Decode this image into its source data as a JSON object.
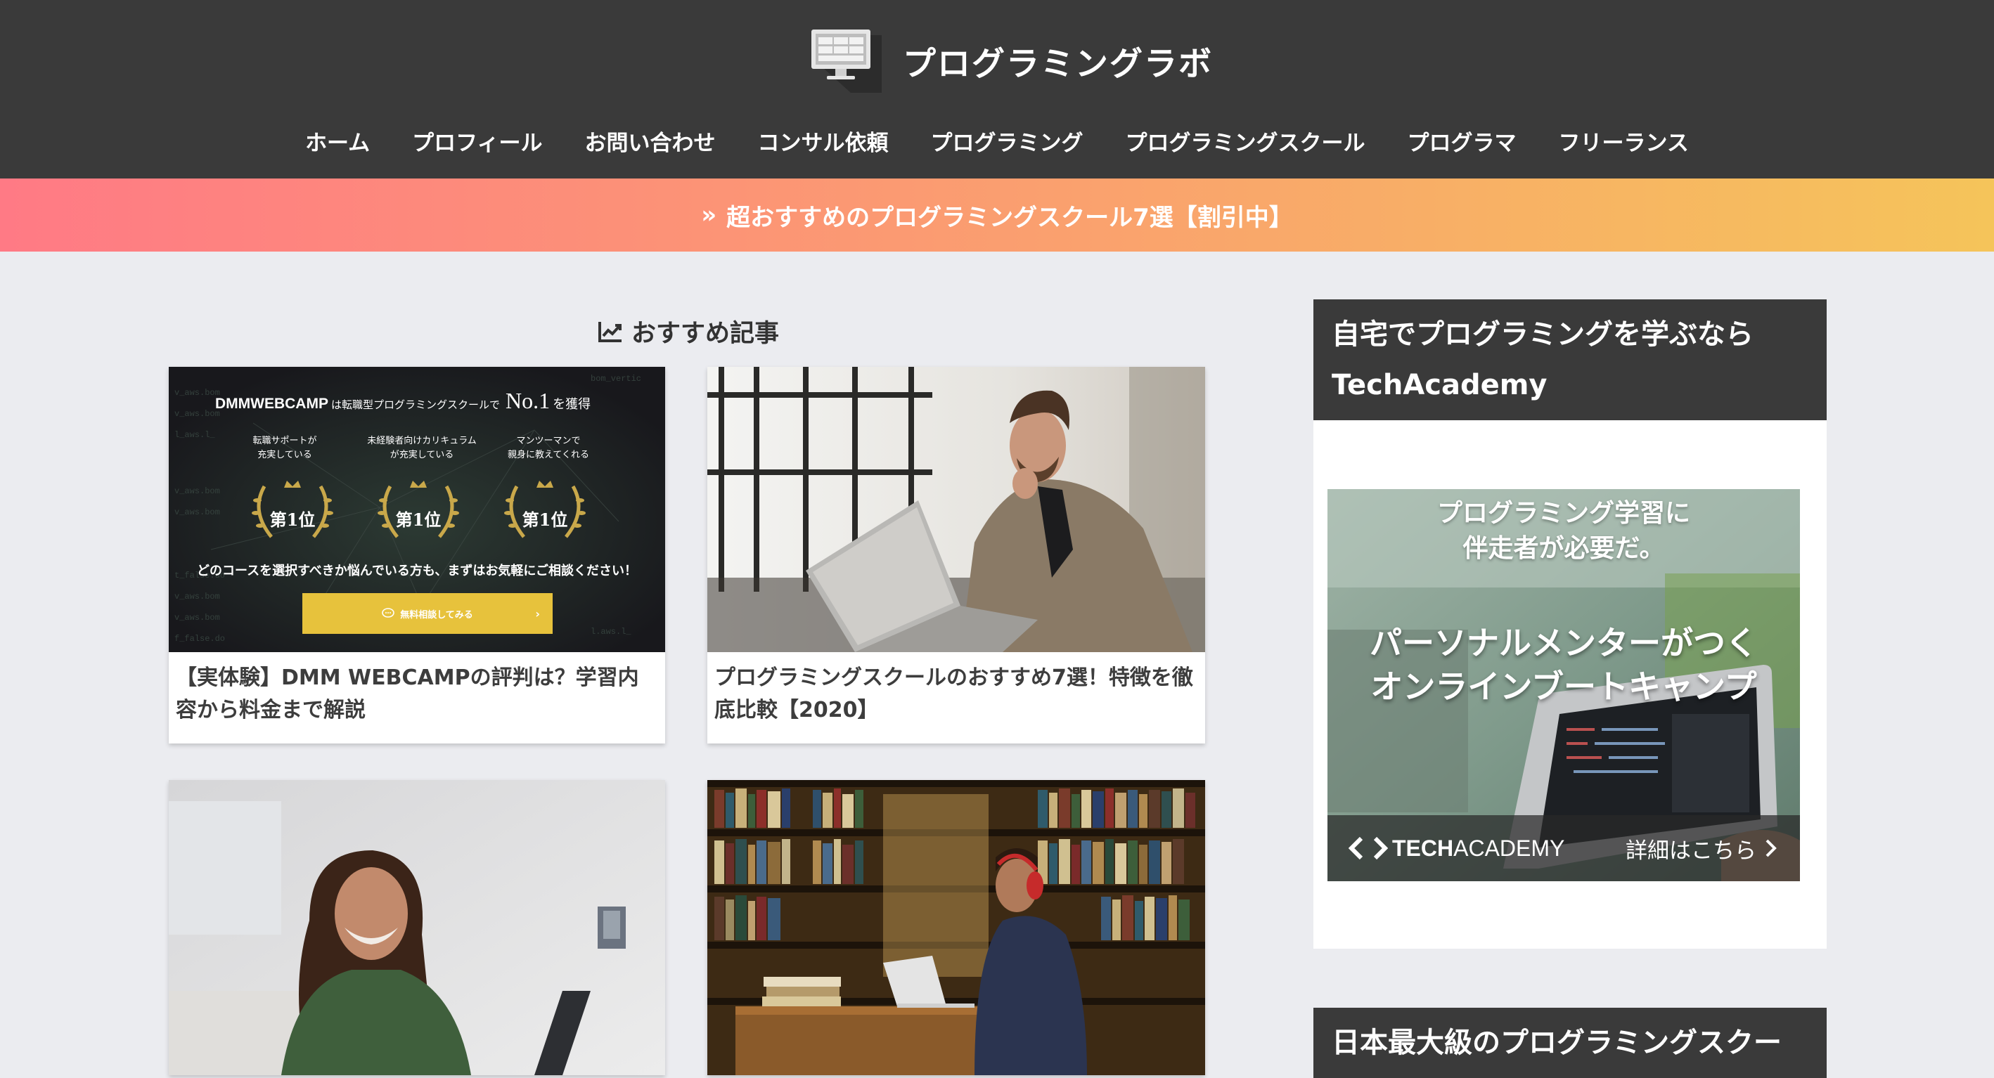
{
  "site": {
    "title": "プログラミングラボ"
  },
  "nav": {
    "items": [
      {
        "label": "ホーム"
      },
      {
        "label": "プロフィール"
      },
      {
        "label": "お問い合わせ"
      },
      {
        "label": "コンサル依頼"
      },
      {
        "label": "プログラミング"
      },
      {
        "label": "プログラミングスクール"
      },
      {
        "label": "プログラマ"
      },
      {
        "label": "フリーランス"
      }
    ]
  },
  "banner": {
    "chevron": "»",
    "text": "超おすすめのプログラミングスクール7選【割引中】"
  },
  "main": {
    "section_title": "おすすめ記事",
    "section_icon": "trending-chart-icon",
    "cards": [
      {
        "title": "【実体験】DMM WEBCAMPの評判は？学習内容から料金まで解説",
        "thumb": {
          "brand": "DMMWEBCAMP",
          "headline_a": "は転職型プログラミングスクールで",
          "headline_no": "No.1",
          "headline_b": "を獲得",
          "award_1": "転職サポートが\n充実している",
          "award_2": "未経験者向けカリキュラム\nが充実している",
          "award_3": "マンツーマンで\n親身に教えてくれる",
          "rank": "第1位",
          "lead": "どのコースを選択すべきか悩んでいる方も、まずはお気軽にご相談ください！",
          "cta": "無料相談してみる"
        }
      },
      {
        "title": "プログラミングスクールのおすすめ7選！特徴を徹底比較【2020】"
      },
      {
        "title": ""
      },
      {
        "title": ""
      }
    ]
  },
  "sidebar": {
    "widget1": {
      "title_line1": "自宅でプログラミングを学ぶなら",
      "title_line2": "TechAcademy",
      "ad": {
        "top_line1": "プログラミング学習に",
        "top_line2": "伴走者が必要だ。",
        "mid_line1": "パーソナルメンターがつく",
        "mid_line2": "オンラインブートキャンプ",
        "brand_a": "TECH",
        "brand_b": "ACADEMY",
        "link": "詳細はこちら"
      }
    },
    "widget2": {
      "title": "日本最大級のプログラミングスクー"
    }
  },
  "colors": {
    "header_bg": "#3a3a3a",
    "page_bg": "#ebecf0",
    "banner_from": "#ff7a85",
    "banner_to": "#f5c45a",
    "cta_yellow": "#e7c23c"
  }
}
